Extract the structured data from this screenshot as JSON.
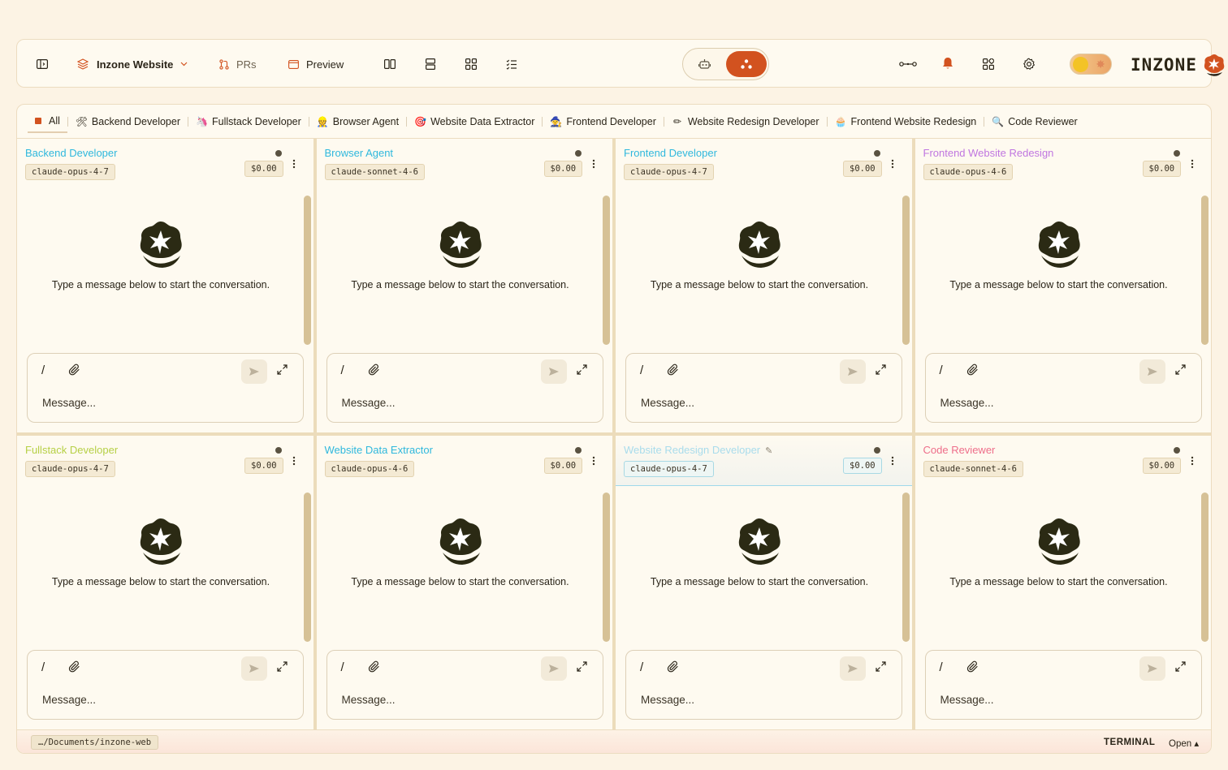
{
  "topbar": {
    "project_name": "Inzone Website",
    "prs_label": "PRs",
    "preview_label": "Preview",
    "brand": "INZONE"
  },
  "colors": {
    "accent": "#d2521f",
    "background": "#fcf3e4",
    "panel": "#fefaf0"
  },
  "tabs": [
    {
      "label": "All",
      "icon": "orange-square"
    },
    {
      "label": "Backend Developer",
      "icon": "🛠"
    },
    {
      "label": "Fullstack Developer",
      "icon": "🦄"
    },
    {
      "label": "Browser Agent",
      "icon": "👷"
    },
    {
      "label": "Website Data Extractor",
      "icon": "🎯"
    },
    {
      "label": "Frontend Developer",
      "icon": "🧙"
    },
    {
      "label": "Website Redesign Developer",
      "icon": "✏"
    },
    {
      "label": "Frontend Website Redesign",
      "icon": "🧁"
    },
    {
      "label": "Code Reviewer",
      "icon": "🔍"
    }
  ],
  "panels": [
    {
      "title": "Backend Developer",
      "title_color": "#2fb8dd",
      "model": "claude-opus-4-7",
      "cost": "$0.00",
      "empty_text": "Type a message below to start the conversation.",
      "placeholder": "Message..."
    },
    {
      "title": "Browser Agent",
      "title_color": "#2fb8dd",
      "model": "claude-sonnet-4-6",
      "cost": "$0.00",
      "empty_text": "Type a message below to start the conversation.",
      "placeholder": "Message..."
    },
    {
      "title": "Frontend Developer",
      "title_color": "#2fb8dd",
      "model": "claude-opus-4-7",
      "cost": "$0.00",
      "empty_text": "Type a message below to start the conversation.",
      "placeholder": "Message..."
    },
    {
      "title": "Frontend Website Redesign",
      "title_color": "#c076e0",
      "model": "claude-opus-4-6",
      "cost": "$0.00",
      "empty_text": "Type a message below to start the conversation.",
      "placeholder": "Message..."
    },
    {
      "title": "Fullstack Developer",
      "title_color": "#b6d046",
      "model": "claude-opus-4-7",
      "cost": "$0.00",
      "empty_text": "Type a message below to start the conversation.",
      "placeholder": "Message..."
    },
    {
      "title": "Website Data Extractor",
      "title_color": "#2fb8dd",
      "model": "claude-opus-4-6",
      "cost": "$0.00",
      "empty_text": "Type a message below to start the conversation.",
      "placeholder": "Message..."
    },
    {
      "title": "Website Redesign Developer",
      "title_color": "#a9dcec",
      "model": "claude-opus-4-7",
      "cost": "$0.00",
      "empty_text": "Type a message below to start the conversation.",
      "placeholder": "Message...",
      "highlight": true
    },
    {
      "title": "Code Reviewer",
      "title_color": "#ee6e8a",
      "model": "claude-sonnet-4-6",
      "cost": "$0.00",
      "empty_text": "Type a message below to start the conversation.",
      "placeholder": "Message..."
    }
  ],
  "statusbar": {
    "path": "…/Documents/inzone-web",
    "terminal_label": "TERMINAL",
    "open_label": "Open ▴"
  }
}
